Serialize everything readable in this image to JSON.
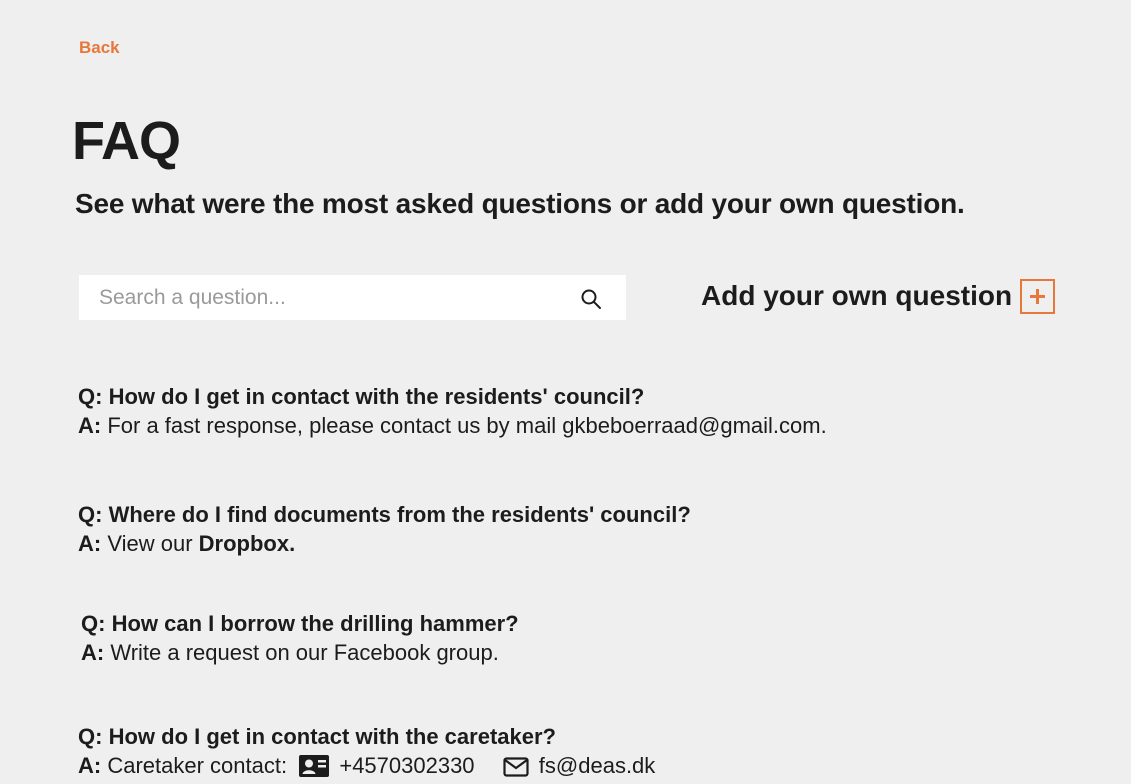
{
  "nav": {
    "back_label": "Back"
  },
  "header": {
    "title": "FAQ",
    "subtitle": "See what were the most asked questions or add your own question."
  },
  "search": {
    "placeholder": "Search a question..."
  },
  "add_question": {
    "label": "Add your own question",
    "button_symbol": "+"
  },
  "faq": {
    "q_prefix": "Q:",
    "a_prefix": "A:",
    "items": [
      {
        "question": "How do I get in contact with the residents' council?",
        "answer": "For a fast response, please contact us by mail gkbeboerraad@gmail.com."
      },
      {
        "question": "Where do I find documents from the residents' council?",
        "answer_pre": "View our",
        "answer_link": "Dropbox."
      },
      {
        "question": "How can I borrow the drilling hammer?",
        "answer": "Write a request on our Facebook group."
      },
      {
        "question": "How do I get in contact with the caretaker?",
        "answer_pre": "Caretaker contact:",
        "phone": "+4570302330",
        "email": "fs@deas.dk"
      }
    ]
  },
  "colors": {
    "accent": "#e8773a",
    "background": "#efefef",
    "text": "#1c1c1c"
  },
  "icons": {
    "search": "search-icon",
    "add": "plus-icon",
    "phone": "contact-card-icon",
    "email": "mail-icon"
  }
}
